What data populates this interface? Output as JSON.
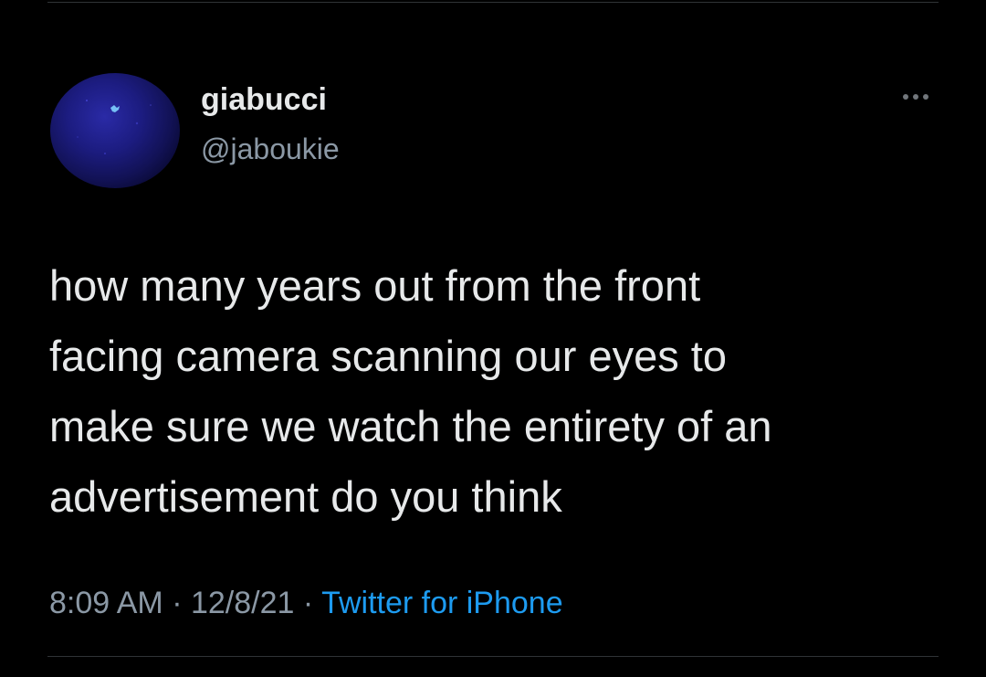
{
  "tweet": {
    "author": {
      "display_name": "giabucci",
      "handle": "@jaboukie",
      "avatar_icon": "avatar-image"
    },
    "more_icon": "more-options-icon",
    "text": "how many years out from the front\nfacing camera scanning our eyes to\nmake sure we watch the entirety of an\nadvertisement do you think",
    "time": "8:09 AM",
    "separator": "·",
    "date": "12/8/21",
    "source": "Twitter for iPhone"
  },
  "colors": {
    "background": "#000000",
    "primary_text": "#e7e9ea",
    "secondary_text": "#8b98a5",
    "link": "#1d9bf0",
    "divider": "#2f3336"
  }
}
